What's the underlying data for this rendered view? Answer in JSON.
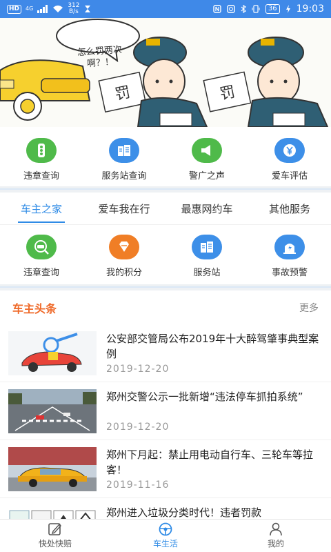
{
  "status_bar": {
    "hd": "HD",
    "network": "4G",
    "speed_value": "312",
    "speed_unit": "B/s",
    "battery": "36",
    "time": "19:03"
  },
  "banner": {
    "bubble_text": "怎么罚两次啊？！",
    "ticket_text": "罚"
  },
  "quick_grid": [
    {
      "label": "违章查询",
      "icon": "traffic-light-icon",
      "color": "#4fba4a"
    },
    {
      "label": "服务站查询",
      "icon": "building-icon",
      "color": "#3d8fe8"
    },
    {
      "label": "警广之声",
      "icon": "megaphone-icon",
      "color": "#4fba4a"
    },
    {
      "label": "爱车评估",
      "icon": "yen-icon",
      "color": "#3d8fe8"
    }
  ],
  "tabs": [
    {
      "label": "车主之家",
      "active": true
    },
    {
      "label": "爱车我在行",
      "active": false
    },
    {
      "label": "最惠网约车",
      "active": false
    },
    {
      "label": "其他服务",
      "active": false
    }
  ],
  "service_grid": [
    {
      "label": "违章查询",
      "icon": "car-search-icon",
      "color": "#4fba4a"
    },
    {
      "label": "我的积分",
      "icon": "diamond-icon",
      "color": "#f07e26"
    },
    {
      "label": "服务站",
      "icon": "building-icon",
      "color": "#3d8fe8"
    },
    {
      "label": "事故预警",
      "icon": "alert-icon",
      "color": "#3d8fe8"
    }
  ],
  "headlines": {
    "title": "车主头条",
    "more": "更多",
    "items": [
      {
        "title": "公安部交管局公布2019年十大醉驾肇事典型案例",
        "date": "2019-12-20"
      },
      {
        "title": "郑州交警公示一批新增“违法停车抓拍系统”",
        "date": "2019-12-20"
      },
      {
        "title": "郑州下月起：禁止用电动自行车、三轮车等拉客！",
        "date": "2019-11-16"
      },
      {
        "title": "郑州进入垃圾分类时代！违者罚款",
        "date": ""
      }
    ]
  },
  "bottom_nav": [
    {
      "label": "快处快赔",
      "icon": "edit-icon",
      "active": false
    },
    {
      "label": "车生活",
      "icon": "steering-wheel-icon",
      "active": true
    },
    {
      "label": "我的",
      "icon": "user-icon",
      "active": false
    }
  ],
  "colors": {
    "accent": "#2f8be6",
    "headline": "#ef6a2a",
    "status_bar": "#3f89e8"
  }
}
